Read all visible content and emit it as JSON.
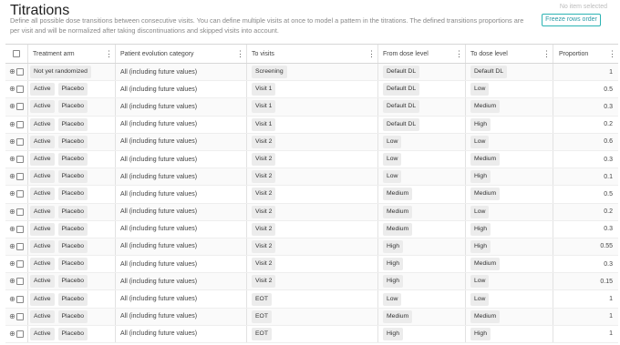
{
  "header": {
    "title": "Titrations",
    "description": "Define all possible dose transitions between consecutive visits. You can define multiple visits at once to model a pattern in the titrations. The defined transitions proportions are per visit and will be normalized after taking discontinuations and skipped visits into account.",
    "no_item_selected": "No item selected",
    "freeze_button": "Freeze rows order"
  },
  "columns": {
    "treatment_arm": "Treatment arm",
    "patient_evolution": "Patient evolution category",
    "to_visits": "To visits",
    "from_dose": "From dose level",
    "to_dose": "To dose level",
    "proportion": "Proportion"
  },
  "rows": [
    {
      "arm1": "Not yet randomized",
      "arm2": "",
      "evo": "All (including future values)",
      "visit": "Screening",
      "from": "Default DL",
      "to": "Default DL",
      "prop": "1"
    },
    {
      "arm1": "Active",
      "arm2": "Placebo",
      "evo": "All (including future values)",
      "visit": "Visit 1",
      "from": "Default DL",
      "to": "Low",
      "prop": "0.5"
    },
    {
      "arm1": "Active",
      "arm2": "Placebo",
      "evo": "All (including future values)",
      "visit": "Visit 1",
      "from": "Default DL",
      "to": "Medium",
      "prop": "0.3"
    },
    {
      "arm1": "Active",
      "arm2": "Placebo",
      "evo": "All (including future values)",
      "visit": "Visit 1",
      "from": "Default DL",
      "to": "High",
      "prop": "0.2"
    },
    {
      "arm1": "Active",
      "arm2": "Placebo",
      "evo": "All (including future values)",
      "visit": "Visit 2",
      "from": "Low",
      "to": "Low",
      "prop": "0.6"
    },
    {
      "arm1": "Active",
      "arm2": "Placebo",
      "evo": "All (including future values)",
      "visit": "Visit 2",
      "from": "Low",
      "to": "Medium",
      "prop": "0.3"
    },
    {
      "arm1": "Active",
      "arm2": "Placebo",
      "evo": "All (including future values)",
      "visit": "Visit 2",
      "from": "Low",
      "to": "High",
      "prop": "0.1"
    },
    {
      "arm1": "Active",
      "arm2": "Placebo",
      "evo": "All (including future values)",
      "visit": "Visit 2",
      "from": "Medium",
      "to": "Medium",
      "prop": "0.5"
    },
    {
      "arm1": "Active",
      "arm2": "Placebo",
      "evo": "All (including future values)",
      "visit": "Visit 2",
      "from": "Medium",
      "to": "Low",
      "prop": "0.2"
    },
    {
      "arm1": "Active",
      "arm2": "Placebo",
      "evo": "All (including future values)",
      "visit": "Visit 2",
      "from": "Medium",
      "to": "High",
      "prop": "0.3"
    },
    {
      "arm1": "Active",
      "arm2": "Placebo",
      "evo": "All (including future values)",
      "visit": "Visit 2",
      "from": "High",
      "to": "High",
      "prop": "0.55"
    },
    {
      "arm1": "Active",
      "arm2": "Placebo",
      "evo": "All (including future values)",
      "visit": "Visit 2",
      "from": "High",
      "to": "Medium",
      "prop": "0.3"
    },
    {
      "arm1": "Active",
      "arm2": "Placebo",
      "evo": "All (including future values)",
      "visit": "Visit 2",
      "from": "High",
      "to": "Low",
      "prop": "0.15"
    },
    {
      "arm1": "Active",
      "arm2": "Placebo",
      "evo": "All (including future values)",
      "visit": "EOT",
      "from": "Low",
      "to": "Low",
      "prop": "1"
    },
    {
      "arm1": "Active",
      "arm2": "Placebo",
      "evo": "All (including future values)",
      "visit": "EOT",
      "from": "Medium",
      "to": "Medium",
      "prop": "1"
    },
    {
      "arm1": "Active",
      "arm2": "Placebo",
      "evo": "All (including future values)",
      "visit": "EOT",
      "from": "High",
      "to": "High",
      "prop": "1"
    }
  ],
  "icons": {
    "drag": "drag-handle-icon",
    "menu": "kebab-menu-icon",
    "checkbox": "checkbox-icon"
  },
  "colors": {
    "accent": "#2bb3b3",
    "chip_bg": "#ececec"
  }
}
